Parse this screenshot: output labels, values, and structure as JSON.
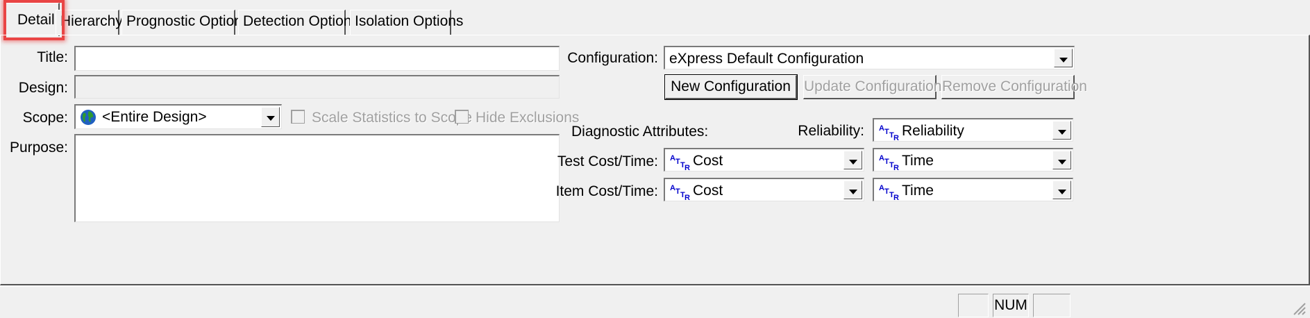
{
  "tabs": [
    {
      "label": "Detail"
    },
    {
      "label": "Hierarchy"
    },
    {
      "label": "Prognostic Options"
    },
    {
      "label": "Detection Options"
    },
    {
      "label": "Isolation Options"
    }
  ],
  "left": {
    "title_label": "Title:",
    "title_value": "",
    "design_label": "Design:",
    "design_value": "",
    "scope_label": "Scope:",
    "scope_value": "<Entire Design>",
    "scale_stats_label": "Scale Statistics to Scope",
    "hide_exclusions_label": "Hide Exclusions",
    "purpose_label": "Purpose:",
    "purpose_value": ""
  },
  "right": {
    "configuration_label": "Configuration:",
    "configuration_value": "eXpress Default Configuration",
    "new_config_button": "New Configuration",
    "update_config_button": "Update Configuration",
    "remove_config_button": "Remove Configuration",
    "diag_attr_label": "Diagnostic Attributes:",
    "reliability_label": "Reliability:",
    "reliability_value": "Reliability",
    "test_cost_time_label": "Test Cost/Time:",
    "test_cost_value": "Cost",
    "test_time_value": "Time",
    "item_cost_time_label": "Item Cost/Time:",
    "item_cost_value": "Cost",
    "item_time_value": "Time"
  },
  "status_bar": {
    "num": "NUM"
  },
  "colors": {
    "background": "#f0f0f0",
    "highlight": "#e94545",
    "attr_icon": "#0000cc",
    "disabled_text": "#a0a0a0"
  },
  "icons": {
    "scope": "globe-icon",
    "attribute": "attribute-icon"
  }
}
